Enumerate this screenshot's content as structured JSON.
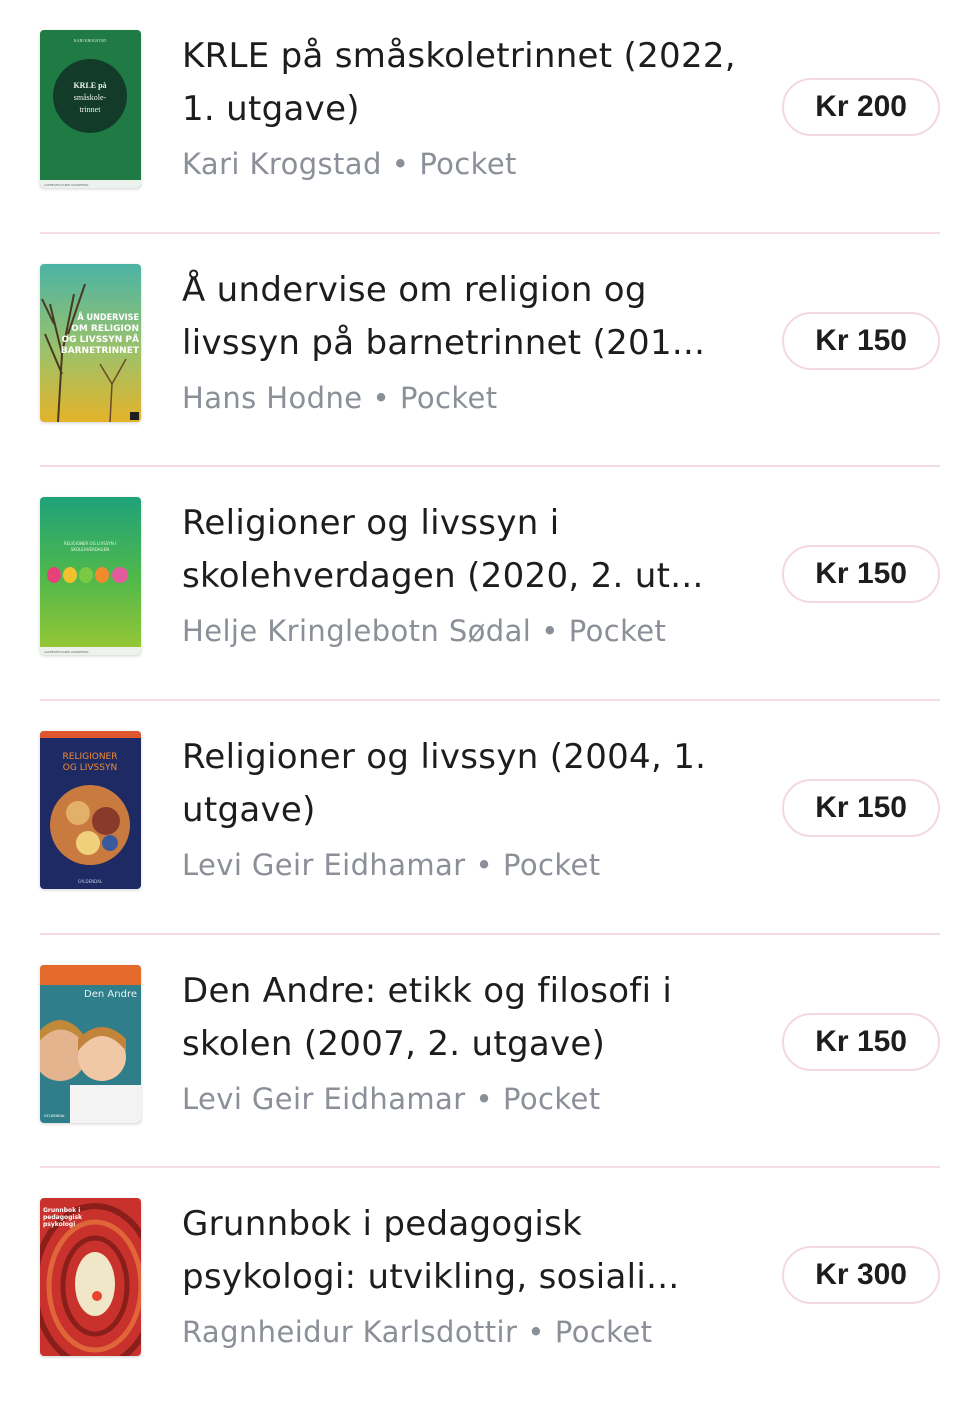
{
  "books": [
    {
      "title": "KRLE på småskoletrinnet (2022, 1. utgave)",
      "author": "Kari Krogstad",
      "format": "Pocket",
      "separator": "•",
      "price": "Kr 200",
      "cover": {
        "top_text": "KARI KROGSTAD",
        "title_text": "KRLE på småskole-trinnet",
        "bottom_text": "CAPPELEN DAMM AKADEMISK",
        "colors": {
          "bg": "#1f7a43",
          "circle": "#123b2a"
        }
      }
    },
    {
      "title": "Å  undervise om religion og livssyn på barnetrinnet (201...",
      "author": "Hans Hodne",
      "format": "Pocket",
      "separator": "•",
      "price": "Kr 150",
      "cover": {
        "title_text": "Å UNDERVISE OM RELIGION OG LIVSSYN PÅ BARNETRINNET",
        "colors": {
          "top": "#4bb3a4",
          "bottom": "#e3b32a"
        }
      }
    },
    {
      "title": "Religioner og livssyn i skolehverdagen (2020, 2. ut...",
      "author": "Helje Kringlebotn Sødal",
      "format": "Pocket",
      "separator": "•",
      "price": "Kr 150",
      "cover": {
        "title_text": "RELIGIONER OG LIVSSYN I SKOLEHVERDAGEN",
        "bottom_text": "CAPPELEN DAMM AKADEMISK",
        "colors": {
          "top": "#1fa27a",
          "bottom": "#9cc833"
        }
      }
    },
    {
      "title": "Religioner og livssyn (2004, 1. utgave)",
      "author": "Levi Geir Eidhamar",
      "format": "Pocket",
      "separator": "•",
      "price": "Kr 150",
      "cover": {
        "title_text": "RELIGIONER OG LIVSSYN",
        "bottom_text": "GYLDENDAL",
        "colors": {
          "bg": "#1d2a63",
          "accent": "#e0562e"
        }
      }
    },
    {
      "title": "Den Andre: etikk og filosofi i skolen (2007, 2. utgave)",
      "author": "Levi Geir Eidhamar",
      "format": "Pocket",
      "separator": "•",
      "price": "Kr 150",
      "cover": {
        "title_text": "Den Andre",
        "bottom_text": "GYLDENDAL",
        "colors": {
          "top": "#e46b2c",
          "bg": "#2f7e8a"
        }
      }
    },
    {
      "title": "Grunnbok i pedagogisk psykologi: utvikling, sosiali...",
      "author": "Ragnheidur Karlsdottir",
      "format": "Pocket",
      "separator": "•",
      "price": "Kr 300",
      "cover": {
        "title_text": "Grunnbok i pedagogisk psykologi",
        "colors": {
          "bg": "#c9322c",
          "accent": "#f0e6c8"
        }
      }
    }
  ]
}
